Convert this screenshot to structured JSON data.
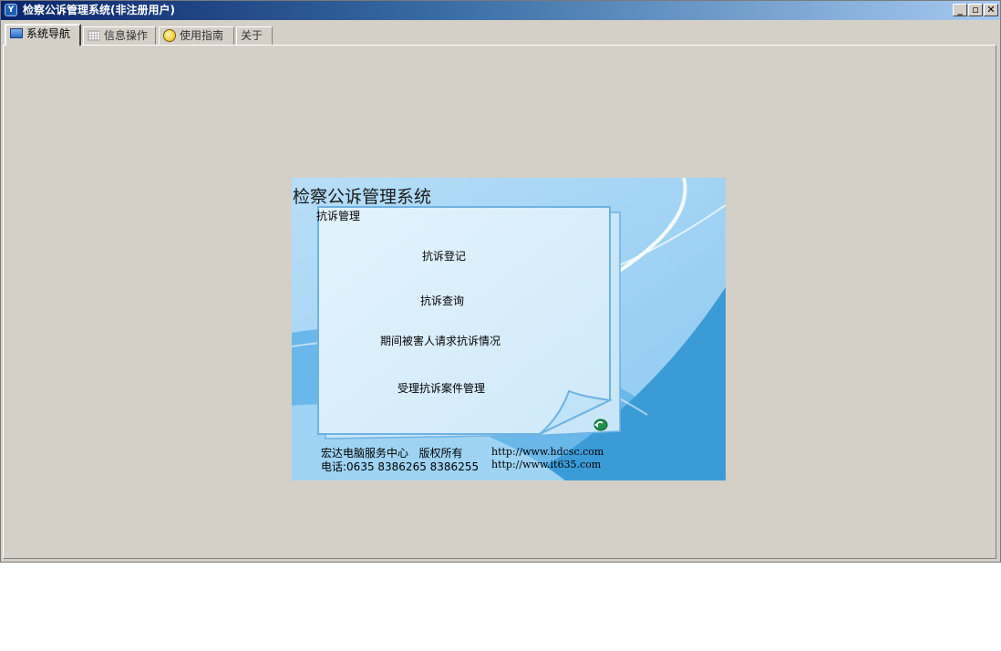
{
  "window": {
    "title": "检察公诉管理系统(非注册用户)",
    "app_icon_glyph": "Y",
    "controls": {
      "minimize": "_",
      "maximize": "▫",
      "close": "✕"
    }
  },
  "tabs": [
    {
      "label": "系统导航",
      "icon": "monitor-icon",
      "active": true
    },
    {
      "label": "信息操作",
      "icon": "grid-icon",
      "active": false
    },
    {
      "label": "使用指南",
      "icon": "guide-icon",
      "active": false
    },
    {
      "label": "关于",
      "icon": "",
      "active": false
    }
  ],
  "nav_panel": {
    "title": "检察公诉管理系统",
    "section": "抗诉管理",
    "links": [
      {
        "label": "抗诉登记"
      },
      {
        "label": "抗诉查询"
      },
      {
        "label": "期间被害人请求抗诉情况"
      },
      {
        "label": "受理抗诉案件管理"
      }
    ],
    "return_icon": "return-arrow-icon",
    "footer": {
      "company": "宏达电脑服务中心   版权所有",
      "phone": "电话:0635 8386265 8386255",
      "url1": "http://www.hdcsc.com",
      "url2": "http://www.it635.com"
    }
  },
  "colors": {
    "titlebar_start": "#0a246a",
    "titlebar_end": "#a6caf0",
    "window_bg": "#d4d0c8",
    "panel_light": "#a8d8f8",
    "panel_dark": "#3b9bd6",
    "note_fill": "#dcf0fb",
    "note_border": "#6fb2e2"
  }
}
